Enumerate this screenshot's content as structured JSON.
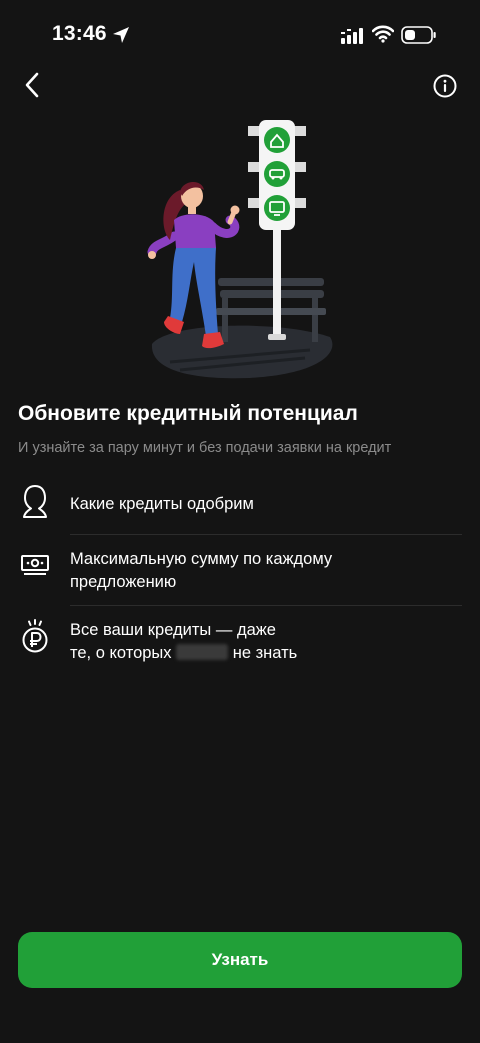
{
  "status_bar": {
    "time": "13:46"
  },
  "nav": {
    "back_icon": "chevron-left-icon",
    "info_icon": "info-circle-icon"
  },
  "illustration": {
    "description_icon": "traffic-light-illustration",
    "colors": {
      "light_green": "#21a038",
      "shirt": "#8a3fc1",
      "jeans": "#3f6fc9",
      "shoes": "#e03a3a",
      "hair": "#6b1a2a"
    }
  },
  "content": {
    "title": "Обновите кредитный потенциал",
    "subtitle": "И узнайте за пару минут и без подачи заявки на кредит"
  },
  "features": [
    {
      "icon": "person-outline-icon",
      "text": "Какие кредиты одобрим"
    },
    {
      "icon": "banknote-icon",
      "line1": "Максимальную сумму по каждому",
      "line2": "предложению"
    },
    {
      "icon": "ruble-coin-icon",
      "line1": "Все ваши кредиты — даже",
      "line2_before": "те, о которых",
      "line2_after": "не знать"
    }
  ],
  "cta": {
    "label": "Узнать",
    "color": "#21a038"
  },
  "theme": {
    "background": "#141414",
    "text": "#ffffff",
    "muted_text": "#8b8b8b",
    "divider": "#2c2c2c"
  }
}
